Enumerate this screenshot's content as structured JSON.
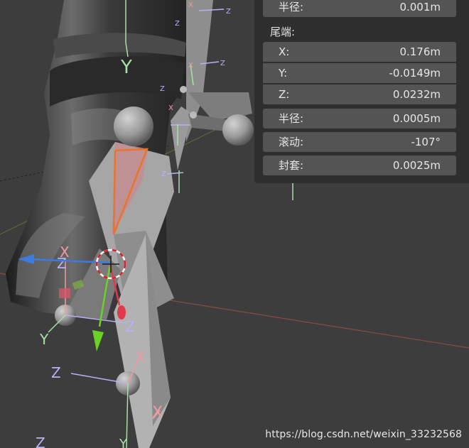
{
  "properties": {
    "head_radius": {
      "label": "半径:",
      "value": "0.001m"
    },
    "tail_section": "尾端:",
    "tail": [
      {
        "label": "X:",
        "value": "0.176m"
      },
      {
        "label": "Y:",
        "value": "-0.0149m"
      },
      {
        "label": "Z:",
        "value": "0.0232m"
      }
    ],
    "tail_radius": {
      "label": "半径:",
      "value": "0.0005m"
    },
    "roll": {
      "label": "滚动:",
      "value": "-107°"
    },
    "envelope": {
      "label": "封套:",
      "value": "0.0025m"
    }
  },
  "gizmo_axes": {
    "x": "X",
    "y": "Y",
    "z": "Z"
  },
  "watermark": "https://blog.csdn.net/weixin_33232568",
  "colors": {
    "background": "#3d3d3d",
    "panel": "#2e2e2e",
    "field": "#545454",
    "x_axis": "#f19aa0",
    "y_axis": "#a9e0a4",
    "z_axis": "#b6b3f2",
    "active_bone": "#e8742d"
  }
}
